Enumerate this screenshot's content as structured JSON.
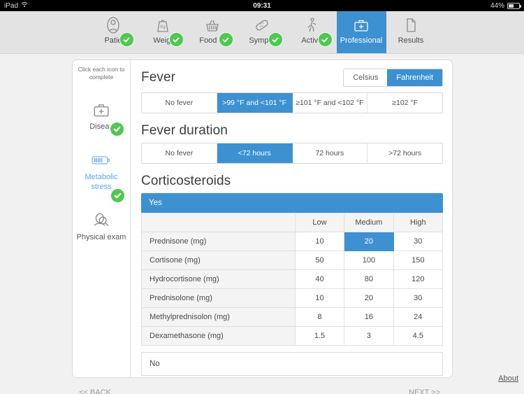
{
  "status_bar": {
    "device": "iPad",
    "wifi_icon": "wifi-icon",
    "time": "09:31",
    "battery_percent": "44%",
    "battery_icon": "battery-icon"
  },
  "tabs": [
    {
      "label": "Patie",
      "icon": "person-icon",
      "completed": true,
      "active": false
    },
    {
      "label": "Weigl",
      "icon": "weight-kg-icon",
      "completed": true,
      "active": false
    },
    {
      "label": "Food In",
      "icon": "food-basket-icon",
      "completed": true,
      "active": false
    },
    {
      "label": "Sympto",
      "icon": "bandage-icon",
      "completed": true,
      "active": false
    },
    {
      "label": "Activit",
      "icon": "walking-icon",
      "completed": true,
      "active": false
    },
    {
      "label": "Professional",
      "icon": "medical-bag-icon",
      "completed": false,
      "active": true
    },
    {
      "label": "Results",
      "icon": "document-icon",
      "completed": false,
      "active": false
    }
  ],
  "sidebar": {
    "hint": "Click each icon to complete",
    "items": [
      {
        "label": "Diseas",
        "icon": "medical-bag-icon",
        "completed": true,
        "active": false
      },
      {
        "label": "Metabolic stress",
        "icon": "battery-icon",
        "completed": true,
        "active": true
      },
      {
        "label": "Physical exam",
        "icon": "exam-person-icon",
        "completed": false,
        "active": false
      }
    ]
  },
  "fever": {
    "title": "Fever",
    "units": {
      "options": [
        "Celsius",
        "Fahrenheit"
      ],
      "selected": "Fahrenheit"
    },
    "options": [
      "No fever",
      ">99 °F and <101 °F",
      "≥101 °F and <102 °F",
      "≥102 °F"
    ],
    "selected": ">99 °F and <101 °F"
  },
  "fever_duration": {
    "title": "Fever duration",
    "options": [
      "No fever",
      "<72 hours",
      "72 hours",
      ">72 hours"
    ],
    "selected": "<72 hours"
  },
  "corticosteroids": {
    "title": "Corticosteroids",
    "yes_label": "Yes",
    "no_label": "No",
    "selected_answer": "Yes",
    "columns": [
      "",
      "Low",
      "Medium",
      "High"
    ],
    "rows": [
      {
        "drug": "Prednisone (mg)",
        "values": [
          "10",
          "20",
          "30"
        ]
      },
      {
        "drug": "Cortisone (mg)",
        "values": [
          "50",
          "100",
          "150"
        ]
      },
      {
        "drug": "Hydrocortisone (mg)",
        "values": [
          "40",
          "80",
          "120"
        ]
      },
      {
        "drug": "Prednisolone (mg)",
        "values": [
          "10",
          "20",
          "30"
        ]
      },
      {
        "drug": "Methylprednisolon (mg)",
        "values": [
          "8",
          "16",
          "24"
        ]
      },
      {
        "drug": "Dexamethasone (mg)",
        "values": [
          "1.5",
          "3",
          "4.5"
        ]
      }
    ],
    "selected_cell": {
      "row": 0,
      "col": 1
    }
  },
  "footer": {
    "back_label": "<< BACK",
    "next_label": "NEXT >>",
    "about_label": "About"
  },
  "colors": {
    "accent_blue": "#3d91d1",
    "check_green": "#4ec94e",
    "page_bg": "#f1f1f1",
    "tabbar_bg": "#e3e3e3"
  }
}
